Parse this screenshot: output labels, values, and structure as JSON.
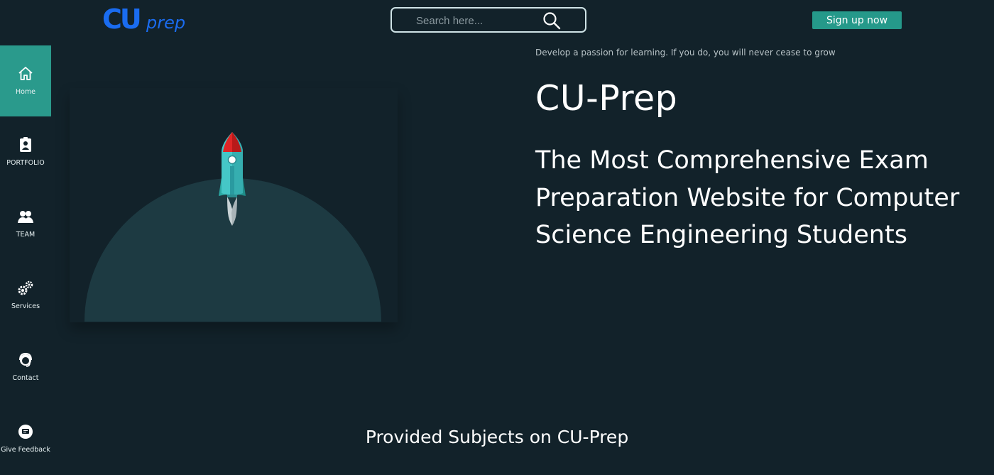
{
  "header": {
    "logo_text": "CUprep",
    "search_placeholder": "Search here...",
    "signup_label": "Sign up now"
  },
  "sidebar": {
    "items": [
      {
        "label": "Home",
        "icon": "home-icon",
        "active": true
      },
      {
        "label": "PORTFOLIO",
        "icon": "portfolio-icon",
        "active": false
      },
      {
        "label": "TEAM",
        "icon": "team-icon",
        "active": false
      },
      {
        "label": "Services",
        "icon": "gears-icon",
        "active": false
      },
      {
        "label": "Contact",
        "icon": "contact-icon",
        "active": false
      },
      {
        "label": "Give Feedback",
        "icon": "feedback-icon",
        "active": false
      }
    ]
  },
  "hero": {
    "tagline": "Develop a passion for learning. If you do, you will never cease to grow",
    "brand": "CU-Prep",
    "headline": "The Most Comprehensive Exam Preparation Website for Computer Science Engineering Students"
  },
  "section": {
    "title": "Provided Subjects on CU-Prep"
  },
  "colors": {
    "background": "#12222a",
    "accent": "#2a9a8c",
    "logo_blue": "#1a6cf0",
    "planet": "#1d3a42"
  }
}
